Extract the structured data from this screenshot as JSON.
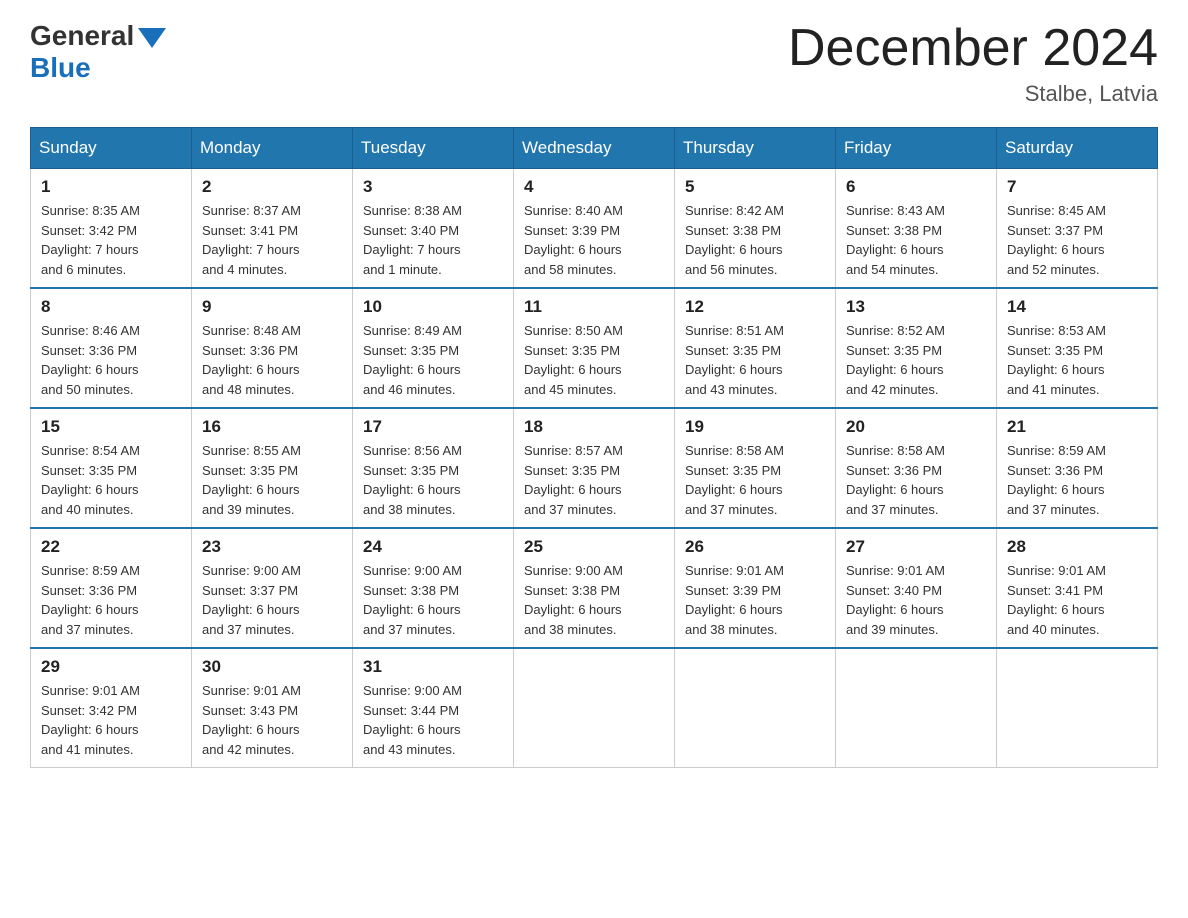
{
  "header": {
    "logo_general": "General",
    "logo_blue": "Blue",
    "month_year": "December 2024",
    "location": "Stalbe, Latvia"
  },
  "weekdays": [
    "Sunday",
    "Monday",
    "Tuesday",
    "Wednesday",
    "Thursday",
    "Friday",
    "Saturday"
  ],
  "weeks": [
    [
      {
        "day": "1",
        "sunrise": "8:35 AM",
        "sunset": "3:42 PM",
        "daylight": "7 hours and 6 minutes."
      },
      {
        "day": "2",
        "sunrise": "8:37 AM",
        "sunset": "3:41 PM",
        "daylight": "7 hours and 4 minutes."
      },
      {
        "day": "3",
        "sunrise": "8:38 AM",
        "sunset": "3:40 PM",
        "daylight": "7 hours and 1 minute."
      },
      {
        "day": "4",
        "sunrise": "8:40 AM",
        "sunset": "3:39 PM",
        "daylight": "6 hours and 58 minutes."
      },
      {
        "day": "5",
        "sunrise": "8:42 AM",
        "sunset": "3:38 PM",
        "daylight": "6 hours and 56 minutes."
      },
      {
        "day": "6",
        "sunrise": "8:43 AM",
        "sunset": "3:38 PM",
        "daylight": "6 hours and 54 minutes."
      },
      {
        "day": "7",
        "sunrise": "8:45 AM",
        "sunset": "3:37 PM",
        "daylight": "6 hours and 52 minutes."
      }
    ],
    [
      {
        "day": "8",
        "sunrise": "8:46 AM",
        "sunset": "3:36 PM",
        "daylight": "6 hours and 50 minutes."
      },
      {
        "day": "9",
        "sunrise": "8:48 AM",
        "sunset": "3:36 PM",
        "daylight": "6 hours and 48 minutes."
      },
      {
        "day": "10",
        "sunrise": "8:49 AM",
        "sunset": "3:35 PM",
        "daylight": "6 hours and 46 minutes."
      },
      {
        "day": "11",
        "sunrise": "8:50 AM",
        "sunset": "3:35 PM",
        "daylight": "6 hours and 45 minutes."
      },
      {
        "day": "12",
        "sunrise": "8:51 AM",
        "sunset": "3:35 PM",
        "daylight": "6 hours and 43 minutes."
      },
      {
        "day": "13",
        "sunrise": "8:52 AM",
        "sunset": "3:35 PM",
        "daylight": "6 hours and 42 minutes."
      },
      {
        "day": "14",
        "sunrise": "8:53 AM",
        "sunset": "3:35 PM",
        "daylight": "6 hours and 41 minutes."
      }
    ],
    [
      {
        "day": "15",
        "sunrise": "8:54 AM",
        "sunset": "3:35 PM",
        "daylight": "6 hours and 40 minutes."
      },
      {
        "day": "16",
        "sunrise": "8:55 AM",
        "sunset": "3:35 PM",
        "daylight": "6 hours and 39 minutes."
      },
      {
        "day": "17",
        "sunrise": "8:56 AM",
        "sunset": "3:35 PM",
        "daylight": "6 hours and 38 minutes."
      },
      {
        "day": "18",
        "sunrise": "8:57 AM",
        "sunset": "3:35 PM",
        "daylight": "6 hours and 37 minutes."
      },
      {
        "day": "19",
        "sunrise": "8:58 AM",
        "sunset": "3:35 PM",
        "daylight": "6 hours and 37 minutes."
      },
      {
        "day": "20",
        "sunrise": "8:58 AM",
        "sunset": "3:36 PM",
        "daylight": "6 hours and 37 minutes."
      },
      {
        "day": "21",
        "sunrise": "8:59 AM",
        "sunset": "3:36 PM",
        "daylight": "6 hours and 37 minutes."
      }
    ],
    [
      {
        "day": "22",
        "sunrise": "8:59 AM",
        "sunset": "3:36 PM",
        "daylight": "6 hours and 37 minutes."
      },
      {
        "day": "23",
        "sunrise": "9:00 AM",
        "sunset": "3:37 PM",
        "daylight": "6 hours and 37 minutes."
      },
      {
        "day": "24",
        "sunrise": "9:00 AM",
        "sunset": "3:38 PM",
        "daylight": "6 hours and 37 minutes."
      },
      {
        "day": "25",
        "sunrise": "9:00 AM",
        "sunset": "3:38 PM",
        "daylight": "6 hours and 38 minutes."
      },
      {
        "day": "26",
        "sunrise": "9:01 AM",
        "sunset": "3:39 PM",
        "daylight": "6 hours and 38 minutes."
      },
      {
        "day": "27",
        "sunrise": "9:01 AM",
        "sunset": "3:40 PM",
        "daylight": "6 hours and 39 minutes."
      },
      {
        "day": "28",
        "sunrise": "9:01 AM",
        "sunset": "3:41 PM",
        "daylight": "6 hours and 40 minutes."
      }
    ],
    [
      {
        "day": "29",
        "sunrise": "9:01 AM",
        "sunset": "3:42 PM",
        "daylight": "6 hours and 41 minutes."
      },
      {
        "day": "30",
        "sunrise": "9:01 AM",
        "sunset": "3:43 PM",
        "daylight": "6 hours and 42 minutes."
      },
      {
        "day": "31",
        "sunrise": "9:00 AM",
        "sunset": "3:44 PM",
        "daylight": "6 hours and 43 minutes."
      },
      null,
      null,
      null,
      null
    ]
  ],
  "labels": {
    "sunrise": "Sunrise:",
    "sunset": "Sunset:",
    "daylight": "Daylight:"
  }
}
